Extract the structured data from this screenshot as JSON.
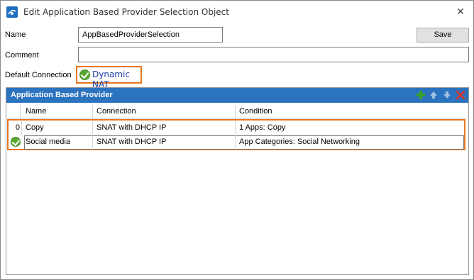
{
  "window": {
    "title": "Edit Application Based Provider Selection Object",
    "close_glyph": "✕"
  },
  "form": {
    "name_label": "Name",
    "name_value": "AppBasedProviderSelection",
    "comment_label": "Comment",
    "comment_value": "",
    "default_connection_label": "Default Connection",
    "default_connection_value": "Dynamic NAT",
    "save_label": "Save"
  },
  "panel": {
    "title": "Application Based Provider",
    "toolbar": [
      "add-icon",
      "move-up-icon",
      "move-down-icon",
      "delete-icon"
    ],
    "columns": [
      "Name",
      "Connection",
      "Condition"
    ],
    "rows": [
      {
        "index": "0",
        "name": "Copy",
        "connection": "SNAT with DHCP IP",
        "condition": "1 Apps: Copy",
        "selected": false
      },
      {
        "index": "",
        "name": "Social media",
        "connection": "SNAT with DHCP IP",
        "condition": "App Categories: Social Networking",
        "selected": true
      }
    ]
  },
  "colors": {
    "header_blue": "#2b73be",
    "highlight_orange": "#e87722",
    "check_green": "#5aa832",
    "link_blue": "#1b3faa"
  }
}
